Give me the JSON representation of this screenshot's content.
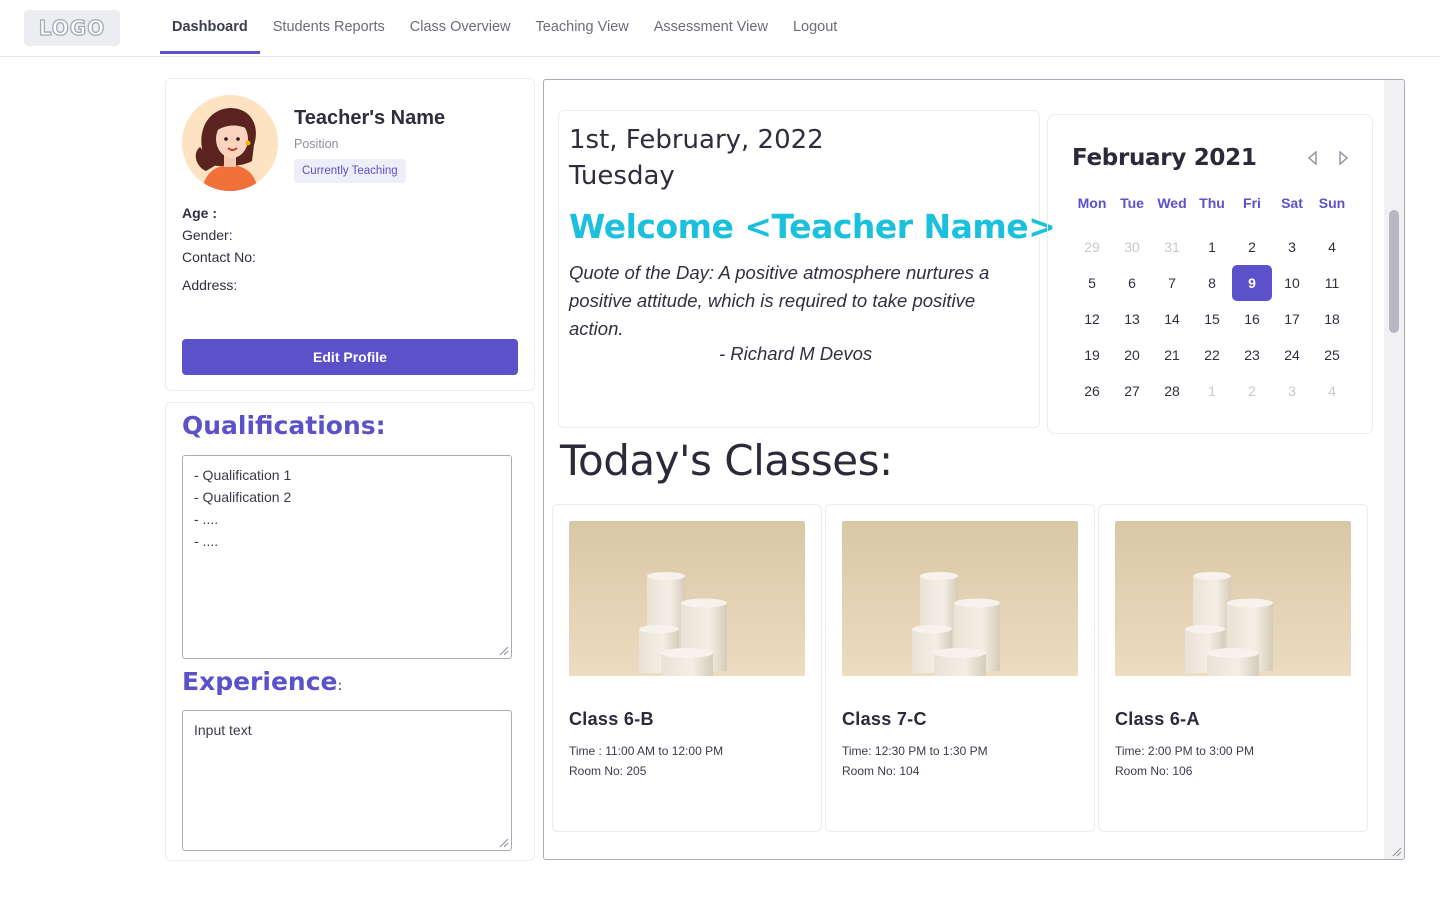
{
  "nav": {
    "logo": "LOGO",
    "items": [
      {
        "label": "Dashboard",
        "active": true
      },
      {
        "label": "Students Reports",
        "active": false
      },
      {
        "label": "Class Overview",
        "active": false
      },
      {
        "label": "Teaching View",
        "active": false
      },
      {
        "label": "Assessment View",
        "active": false
      },
      {
        "label": "Logout",
        "active": false
      }
    ]
  },
  "profile": {
    "name": "Teacher's Name",
    "position": "Position",
    "badge": "Currently Teaching",
    "age_label": "Age :",
    "gender_label": "Gender:",
    "contact_label": "Contact No:",
    "address_label": "Address:",
    "edit_button": "Edit Profile"
  },
  "qualifications": {
    "title": "Qualifications:",
    "lines": [
      "- Qualification 1",
      "- Qualification 2",
      "- ....",
      "- ...."
    ]
  },
  "experience": {
    "title": "Experience",
    "colon": ":",
    "value": "Input text"
  },
  "welcome": {
    "date": "1st, February, 2022",
    "weekday": "Tuesday",
    "greeting": "Welcome <Teacher Name>",
    "quote": "Quote of the Day: A positive atmosphere nurtures a positive attitude, which is required to take positive action.",
    "author": "- Richard M Devos"
  },
  "calendar": {
    "title": "February 2021",
    "weekdays": [
      "Mon",
      "Tue",
      "Wed",
      "Thu",
      "Fri",
      "Sat",
      "Sun"
    ],
    "weeks": [
      [
        {
          "d": "29",
          "m": true
        },
        {
          "d": "30",
          "m": true
        },
        {
          "d": "31",
          "m": true
        },
        {
          "d": "1"
        },
        {
          "d": "2"
        },
        {
          "d": "3"
        },
        {
          "d": "4"
        }
      ],
      [
        {
          "d": "5"
        },
        {
          "d": "6"
        },
        {
          "d": "7"
        },
        {
          "d": "8"
        },
        {
          "d": "9",
          "s": true
        },
        {
          "d": "10"
        },
        {
          "d": "11"
        }
      ],
      [
        {
          "d": "12"
        },
        {
          "d": "13"
        },
        {
          "d": "14"
        },
        {
          "d": "15"
        },
        {
          "d": "16"
        },
        {
          "d": "17"
        },
        {
          "d": "18"
        }
      ],
      [
        {
          "d": "19"
        },
        {
          "d": "20"
        },
        {
          "d": "21"
        },
        {
          "d": "22"
        },
        {
          "d": "23"
        },
        {
          "d": "24"
        },
        {
          "d": "25"
        }
      ],
      [
        {
          "d": "26"
        },
        {
          "d": "27"
        },
        {
          "d": "28"
        },
        {
          "d": "1",
          "m": true
        },
        {
          "d": "2",
          "m": true
        },
        {
          "d": "3",
          "m": true
        },
        {
          "d": "4",
          "m": true
        }
      ]
    ]
  },
  "today": {
    "title": "Today's Classes:",
    "classes": [
      {
        "name": "Class 6-B",
        "time": "Time : 11:00 AM to 12:00 PM",
        "room": "Room No: 205"
      },
      {
        "name": "Class 7-C",
        "time": "Time: 12:30 PM to 1:30 PM",
        "room": "Room No: 104"
      },
      {
        "name": "Class 6-A",
        "time": "Time: 2:00 PM to 3:00 PM",
        "room": "Room No: 106"
      }
    ]
  },
  "colors": {
    "accent": "#5b52c9",
    "welcome": "#1bc0dd",
    "text": "#2a2a3a",
    "muted": "#c7c8d0"
  }
}
